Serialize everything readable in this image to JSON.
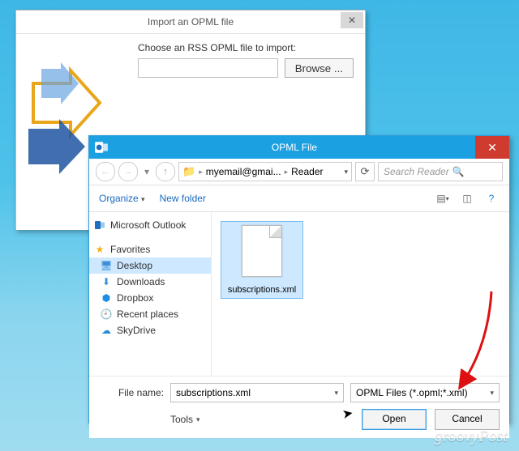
{
  "wizard": {
    "title": "Import an OPML file",
    "label": "Choose an RSS OPML file to import:",
    "input_value": "",
    "browse_label": "Browse ..."
  },
  "dialog": {
    "title": "OPML File",
    "breadcrumb": {
      "p1": "myemail@gmai...",
      "p2": "Reader"
    },
    "search_placeholder": "Search Reader",
    "tools": {
      "organize": "Organize",
      "newfolder": "New folder"
    },
    "sidebar": {
      "outlook": "Microsoft Outlook",
      "fav_header": "Favorites",
      "items": [
        {
          "label": "Desktop"
        },
        {
          "label": "Downloads"
        },
        {
          "label": "Dropbox"
        },
        {
          "label": "Recent places"
        },
        {
          "label": "SkyDrive"
        }
      ]
    },
    "file": {
      "name": "subscriptions.xml"
    },
    "footer": {
      "filename_label": "File name:",
      "filename_value": "subscriptions.xml",
      "filetype_value": "OPML Files (*.opml;*.xml)",
      "tools_label": "Tools",
      "open_label": "Open",
      "cancel_label": "Cancel"
    }
  },
  "watermark": "groovyPost"
}
